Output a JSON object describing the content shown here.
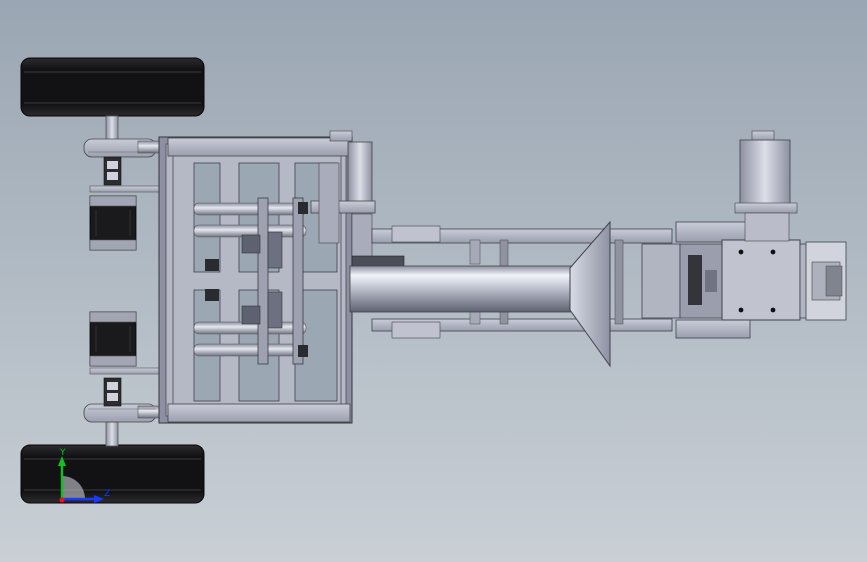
{
  "colors": {
    "background_top": "#9aa6b3",
    "background_bottom": "#c9cfd5",
    "metal_light": "#d8dce6",
    "metal_mid": "#a7abba",
    "metal_dark": "#5b5f6d",
    "tire": "#1c1c1e",
    "motor": "#17171a",
    "axis_x": "#e8101a",
    "axis_y": "#10c020",
    "axis_z": "#1a3aff"
  },
  "triad": {
    "y_label": "Y",
    "z_label": "Z"
  },
  "icons": [
    "triad-icon"
  ]
}
